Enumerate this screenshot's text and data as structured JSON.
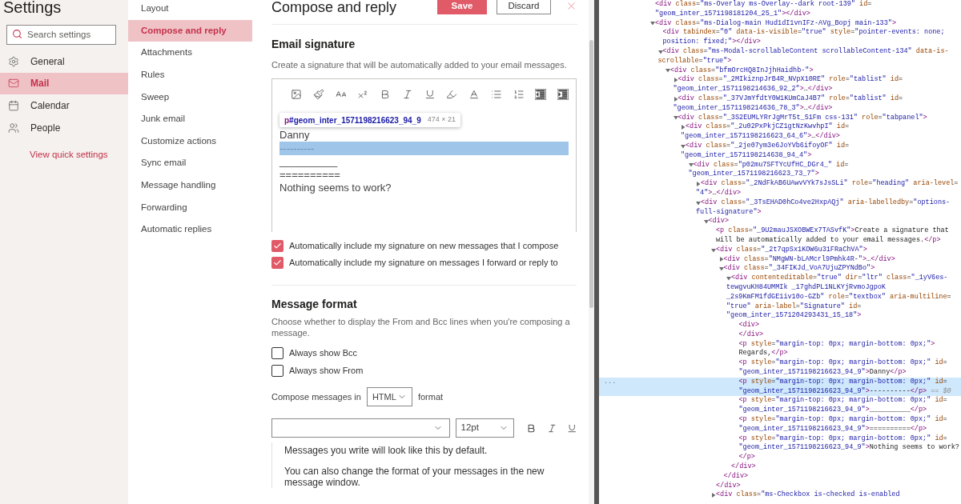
{
  "settings_nav": {
    "title": "Settings",
    "search": {
      "placeholder": "Search settings"
    },
    "items": [
      {
        "label": "General",
        "selected": false
      },
      {
        "label": "Mail",
        "selected": true
      },
      {
        "label": "Calendar",
        "selected": false
      },
      {
        "label": "People",
        "selected": false
      }
    ],
    "link": "View quick settings"
  },
  "mail_menu": [
    {
      "label": "Layout",
      "selected": false
    },
    {
      "label": "Compose and reply",
      "selected": true
    },
    {
      "label": "Attachments",
      "selected": false
    },
    {
      "label": "Rules",
      "selected": false
    },
    {
      "label": "Sweep",
      "selected": false
    },
    {
      "label": "Junk email",
      "selected": false
    },
    {
      "label": "Customize actions",
      "selected": false
    },
    {
      "label": "Sync email",
      "selected": false
    },
    {
      "label": "Message handling",
      "selected": false
    },
    {
      "label": "Forwarding",
      "selected": false
    },
    {
      "label": "Automatic replies",
      "selected": false
    }
  ],
  "panel": {
    "title": "Compose and reply",
    "save": "Save",
    "discard": "Discard",
    "signature": {
      "heading": "Email signature",
      "description": "Create a signature that will be automatically added to your email messages.",
      "lines": [
        {
          "text": "Danny",
          "highlighted": false
        },
        {
          "text": "----------",
          "highlighted": true
        },
        {
          "text": "__________",
          "highlighted": false
        },
        {
          "text": "==========",
          "highlighted": false
        },
        {
          "text": "Nothing seems to work?",
          "highlighted": false
        }
      ],
      "inspect_tooltip": {
        "tag": "p",
        "id": "#geom_inter_1571198216623_94_9",
        "size": "474 × 21"
      },
      "options": [
        {
          "label": "Automatically include my signature on new messages that I compose",
          "checked": true
        },
        {
          "label": "Automatically include my signature on messages I forward or reply to",
          "checked": true
        }
      ]
    },
    "message_format": {
      "heading": "Message format",
      "description": "Choose whether to display the From and Bcc lines when you're composing a message.",
      "options": [
        {
          "label": "Always show Bcc",
          "checked": false
        },
        {
          "label": "Always show From",
          "checked": false
        }
      ],
      "compose_label": "Compose messages in",
      "format": "HTML",
      "format_suffix": "format",
      "font_size": "12pt",
      "preview": [
        "Messages you write will look like this by default.",
        "You can also change the format of your messages in the new message window."
      ]
    }
  },
  "devtools": {
    "nodes": [
      {
        "selected": false,
        "lines": [
          "<div class=\"ms-Overlay ms-Overlay--dark root-139\" id=",
          "\"geom_inter_1571198181204_25_1\"></div>"
        ]
      },
      {
        "expanded": true,
        "selected": false,
        "lines": [
          "<div class=\"ms-Dialog-main Hud1dI1vnIFz-AVg_Bopj main-133\">"
        ],
        "children": [
          {
            "selected": false,
            "lines": [
              "<div tabindex=\"0\" data-is-visible=\"true\" style=\"pointer-events: none;",
              "position: fixed;\"></div>"
            ]
          },
          {
            "expanded": true,
            "selected": false,
            "lines": [
              "<div class=\"ms-Modal-scrollableContent scrollableContent-134\" data-is-",
              "scrollable=\"true\">"
            ],
            "children": [
              {
                "expanded": true,
                "selected": false,
                "lines": [
                  "<div class=\"bfmOrcHQ8InJjhHaidhb-\">"
                ],
                "children": [
                  {
                    "expanded": false,
                    "selected": false,
                    "lines": [
                      "<div class=\"_2MIkiznpJrB4R_NVpX10RE\" role=\"tablist\" id=",
                      "\"geom_inter_1571198214636_92_2\">…</div>"
                    ]
                  },
                  {
                    "expanded": false,
                    "selected": false,
                    "lines": [
                      "<div class=\"_37VJmYfdtY0W1KUmCaJ4B7\" role=\"tablist\" id=",
                      "\"geom_inter_1571198214636_78_3\">…</div>"
                    ]
                  },
                  {
                    "expanded": true,
                    "selected": false,
                    "lines": [
                      "<div class=\"_3S2EUMLYRrJgMrT5t_51Fm css-131\" role=\"tabpanel\">"
                    ],
                    "children": [
                      {
                        "expanded": false,
                        "selected": false,
                        "lines": [
                          "<div class=\"_2u02PxPkjCZ1gtNzKwvhpI\" id=",
                          "\"geom_inter_1571198216623_64_6\">…</div>"
                        ]
                      },
                      {
                        "expanded": true,
                        "selected": false,
                        "lines": [
                          "<div class=\"_2je07ym3e6JoYVb6ifoyOF\" id=",
                          "\"geom_inter_1571198214638_94_4\">"
                        ],
                        "children": [
                          {
                            "expanded": true,
                            "selected": false,
                            "lines": [
                              "<div class=\"p02mu7SFTYcUfHC_DGr4_\" id=",
                              "\"geom_inter_1571198216623_73_7\">"
                            ],
                            "children": [
                              {
                                "expanded": false,
                                "selected": false,
                                "lines": [
                                  "<div class=\"_2NdFkAB6UAwvVYk7sJsSLi\" role=\"heading\" aria-level=",
                                  "\"4\">…</div>"
                                ]
                              },
                              {
                                "expanded": true,
                                "selected": false,
                                "lines": [
                                  "<div class=\"_3TsEHAD0hCo4ve2HxpAQj\" aria-labelledby=\"options-",
                                  "full-signature\">"
                                ],
                                "children": [
                                  {
                                    "expanded": true,
                                    "selected": false,
                                    "lines": [
                                      "<div>"
                                    ],
                                    "children": [
                                      {
                                        "selected": false,
                                        "lines": [
                                          "<p class=\"_9U2mauJSXOBWEx7TASvfK\">Create a signature that",
                                          "will be automatically added to your email messages.</p>"
                                        ]
                                      },
                                      {
                                        "expanded": true,
                                        "selected": false,
                                        "lines": [
                                          "<div class=\"_2t7qpSx1KOW6u31FRaChVA\">"
                                        ],
                                        "close": [
                                          "</div>"
                                        ],
                                        "children": [
                                          {
                                            "expanded": false,
                                            "selected": false,
                                            "lines": [
                                              "<div class=\"NMgWN-bLAMcrl9Pmhk4R-\">…</div>"
                                            ]
                                          },
                                          {
                                            "expanded": true,
                                            "selected": false,
                                            "lines": [
                                              "<div class=\"_34FIKJd_VoA7UjuZPYNdBo\">"
                                            ],
                                            "close": [
                                              "</div>"
                                            ],
                                            "children": [
                                              {
                                                "expanded": true,
                                                "selected": false,
                                                "lines": [
                                                  "<div contenteditable=\"true\" dir=\"ltr\" class=\"_1yV6es-",
                                                  "tewgvuKH84UMMIk _17ghdPL1NLKYjRvmoJgpoK",
                                                  "_2s9KmFM1fdGE1iv10o-GZb\" role=\"textbox\" aria-multiline=",
                                                  "\"true\" aria-label=\"Signature\" id=",
                                                  "\"geom_inter_1571204293431_15_18\">"
                                                ],
                                                "close": [
                                                  "</div>"
                                                ],
                                                "children": [
                                                  {
                                                    "selected": false,
                                                    "lines": [
                                                      "<div>",
                                                      "</div>"
                                                    ]
                                                  },
                                                  {
                                                    "selected": false,
                                                    "lines": [
                                                      "<p style=\"margin-top: 0px; margin-bottom: 0px;\">",
                                                      "Regards,</p>"
                                                    ]
                                                  },
                                                  {
                                                    "selected": false,
                                                    "lines": [
                                                      "<p style=\"margin-top: 0px; margin-bottom: 0px;\" id=",
                                                      "\"geom_inter_1571198216623_94_9\">Danny</p>"
                                                    ]
                                                  },
                                                  {
                                                    "selected": true,
                                                    "gutter": "...",
                                                    "suffix": "== $0",
                                                    "lines": [
                                                      "<p style=\"margin-top: 0px; margin-bottom: 0px;\" id=",
                                                      "\"geom_inter_1571198216623_94_9\">----------</p>"
                                                    ]
                                                  },
                                                  {
                                                    "selected": false,
                                                    "lines": [
                                                      "<p style=\"margin-top: 0px; margin-bottom: 0px;\" id=",
                                                      "\"geom_inter_1571198216623_94_9\">__________</p>"
                                                    ]
                                                  },
                                                  {
                                                    "selected": false,
                                                    "lines": [
                                                      "<p style=\"margin-top: 0px; margin-bottom: 0px;\" id=",
                                                      "\"geom_inter_1571198216623_94_9\">==========</p>"
                                                    ]
                                                  },
                                                  {
                                                    "selected": false,
                                                    "lines": [
                                                      "<p style=\"margin-top: 0px; margin-bottom: 0px;\" id=",
                                                      "\"geom_inter_1571198216623_94_9\">Nothing seems to work?",
                                                      "</p>"
                                                    ]
                                                  }
                                                ]
                                              }
                                            ]
                                          }
                                        ]
                                      },
                                      {
                                        "expanded": false,
                                        "selected": false,
                                        "lines": [
                                          "<div class=\"ms-Checkbox is-checked is-enabled"
                                        ]
                                      }
                                    ]
                                  }
                                ]
                              }
                            ]
                          }
                        ]
                      }
                    ]
                  }
                ]
              }
            ]
          }
        ]
      }
    ]
  }
}
